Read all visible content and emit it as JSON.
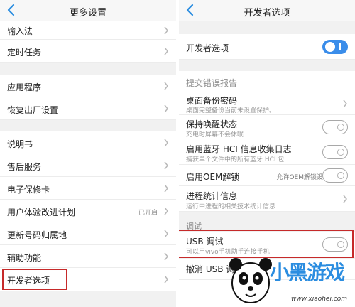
{
  "left": {
    "title": "更多设置",
    "rows": {
      "input_method": "输入法",
      "scheduled_tasks": "定时任务",
      "apps": "应用程序",
      "factory_reset": "恢复出厂设置",
      "manual": "说明书",
      "after_sales": "售后服务",
      "warranty_card": "电子保修卡",
      "ux_program": "用户体验改进计划",
      "ux_program_status": "已开启",
      "update_number_location": "更新号码归属地",
      "accessibility": "辅助功能",
      "developer_options": "开发者选项"
    }
  },
  "right": {
    "title": "开发者选项",
    "developer_options_label": "开发者选项",
    "developer_options_enabled": true,
    "bug_report": "提交错误报告",
    "desktop_backup_password": "桌面备份密码",
    "desktop_backup_password_desc": "桌面完整备份当前未设置保护。",
    "stay_awake": "保持唤醒状态",
    "stay_awake_desc": "充电时屏幕不会休眠",
    "stay_awake_enabled": false,
    "hci_log": "启用蓝牙 HCI 信息收集日志",
    "hci_log_desc": "捕获单个文件中的所有蓝牙 HCI 包",
    "hci_log_enabled": false,
    "oem_unlock": "启用OEM解锁",
    "oem_unlock_note": "允许OEM解锁设备",
    "oem_unlock_enabled": false,
    "process_stats": "进程统计信息",
    "process_stats_desc": "运行中进程的相关技术统计信息",
    "debug_section": "调试",
    "usb_debugging": "USB 调试",
    "usb_debugging_desc": "可以用vivo手机助手连接手机",
    "usb_debugging_enabled": false,
    "revoke_usb": "撤消 USB 调"
  },
  "watermark": {
    "chars": "小黑游戏",
    "url": "www.xiaohei.com"
  },
  "colors": {
    "accent": "#3a8dea",
    "highlight": "#c62a2a"
  },
  "icons": [
    "back-arrow-icon",
    "chevron-right-icon",
    "toggle-switch"
  ]
}
